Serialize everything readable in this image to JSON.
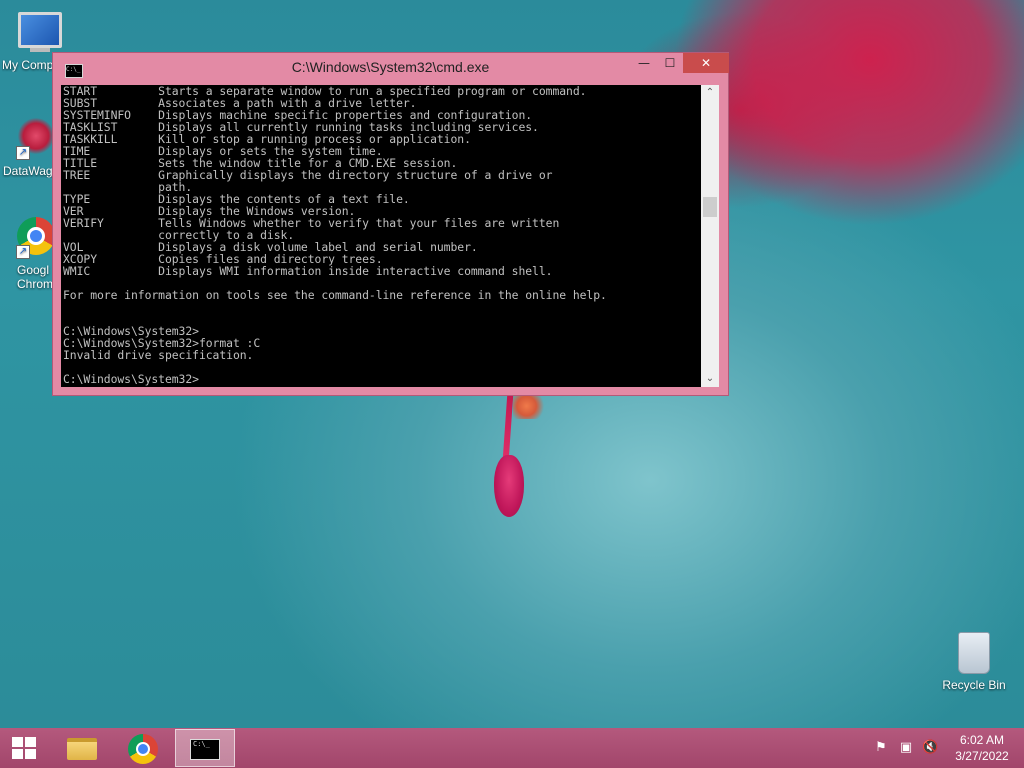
{
  "desktop": {
    "icons": [
      {
        "label": "My Comp",
        "icon": "monitor-icon"
      },
      {
        "label": "DataWag",
        "icon": "datawag-icon"
      },
      {
        "label": "Googl\nChrom",
        "icon": "chrome-icon"
      },
      {
        "label": "Recycle Bin",
        "icon": "recycle-bin-icon"
      }
    ]
  },
  "cmd_window": {
    "title": "C:\\Windows\\System32\\cmd.exe",
    "minimize_glyph": "—",
    "maximize_glyph": "☐",
    "close_glyph": "✕",
    "console_lines": [
      "START         Starts a separate window to run a specified program or command.",
      "SUBST         Associates a path with a drive letter.",
      "SYSTEMINFO    Displays machine specific properties and configuration.",
      "TASKLIST      Displays all currently running tasks including services.",
      "TASKKILL      Kill or stop a running process or application.",
      "TIME          Displays or sets the system time.",
      "TITLE         Sets the window title for a CMD.EXE session.",
      "TREE          Graphically displays the directory structure of a drive or",
      "              path.",
      "TYPE          Displays the contents of a text file.",
      "VER           Displays the Windows version.",
      "VERIFY        Tells Windows whether to verify that your files are written",
      "              correctly to a disk.",
      "VOL           Displays a disk volume label and serial number.",
      "XCOPY         Copies files and directory trees.",
      "WMIC          Displays WMI information inside interactive command shell.",
      "",
      "For more information on tools see the command-line reference in the online help.",
      "",
      "",
      "C:\\Windows\\System32>",
      "C:\\Windows\\System32>format :C",
      "Invalid drive specification.",
      "",
      "C:\\Windows\\System32>"
    ]
  },
  "taskbar": {
    "start_icon": "windows-logo-icon",
    "pinned": [
      {
        "name": "file-explorer",
        "icon": "folder-icon"
      },
      {
        "name": "google-chrome",
        "icon": "chrome-icon"
      },
      {
        "name": "command-prompt",
        "icon": "cmd-icon",
        "active": true
      }
    ],
    "tray": {
      "icons": [
        "flag-icon",
        "network-icon",
        "volume-muted-icon"
      ],
      "time": "6:02 AM",
      "date": "3/27/2022"
    }
  },
  "colors": {
    "window_frame": "#e38aa5",
    "console_bg": "#000000",
    "console_text": "#c0c0c0",
    "taskbar": "#a84670"
  }
}
